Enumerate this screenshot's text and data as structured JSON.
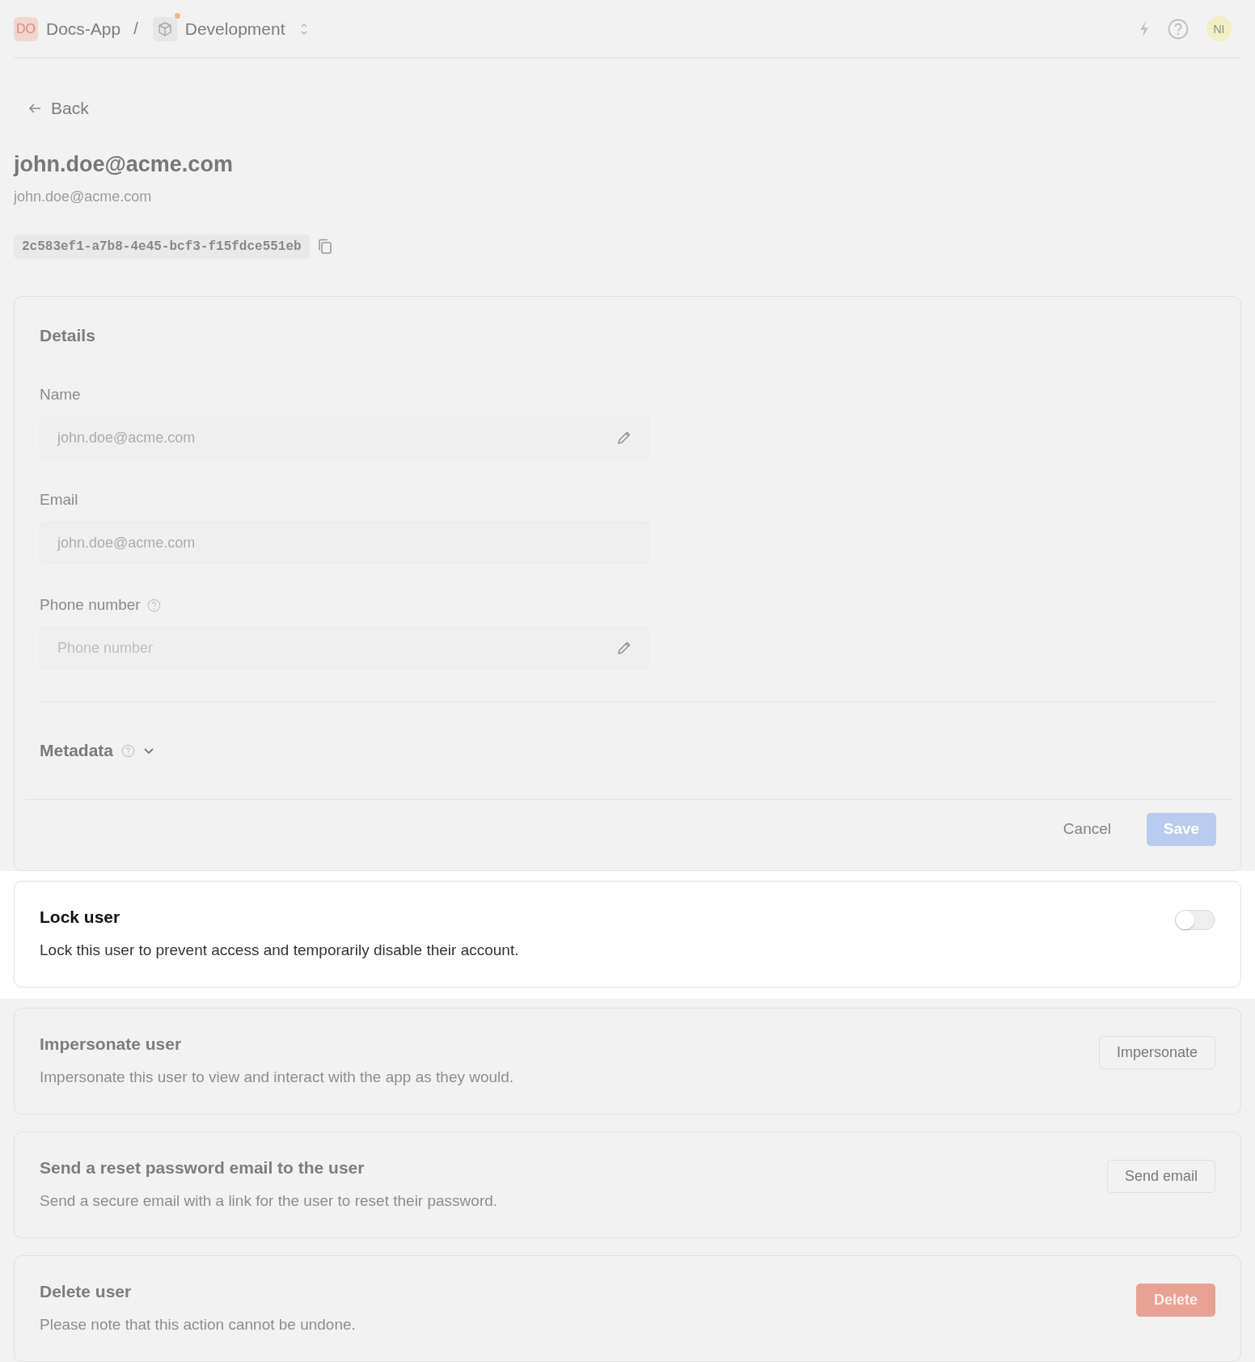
{
  "header": {
    "org_badge": "DO",
    "org": "Docs-App",
    "separator": "/",
    "environment": "Development",
    "environment_notice": true,
    "avatar": "NI"
  },
  "back_link": "Back",
  "user": {
    "title": "john.doe@acme.com",
    "subtitle": "john.doe@acme.com",
    "id": "2c583ef1-a7b8-4e45-bcf3-f15fdce551eb"
  },
  "details": {
    "title": "Details",
    "fields": [
      {
        "label": "Name",
        "value": "john.doe@acme.com",
        "help": false,
        "editable": true
      },
      {
        "label": "Email",
        "value": "john.doe@acme.com",
        "help": false,
        "editable": false
      },
      {
        "label": "Phone number",
        "placeholder": "Phone number",
        "help": true,
        "editable": true
      }
    ],
    "metadata": {
      "label": "Metadata",
      "expanded": false
    },
    "cancel_button": "Cancel",
    "save_button": {
      "label": "Save",
      "disabled": true
    }
  },
  "sections": [
    {
      "kind": "toggle",
      "title": "Lock user",
      "description": "Lock this user to prevent access and temporarily disable their account.",
      "on": false,
      "highlighted": true
    },
    {
      "kind": "button",
      "title": "Impersonate user",
      "description": "Impersonate this user to view and interact with the app as they would.",
      "button": "Impersonate",
      "danger": false,
      "highlighted": false
    },
    {
      "kind": "button",
      "title": "Send a reset password email to the user",
      "description": "Send a secure email with a link for the user to reset their password.",
      "button": "Send email",
      "danger": false,
      "highlighted": false
    },
    {
      "kind": "button",
      "title": "Delete user",
      "description": "Please note that this action cannot be undone.",
      "button": "Delete",
      "danger": true,
      "highlighted": false
    }
  ]
}
